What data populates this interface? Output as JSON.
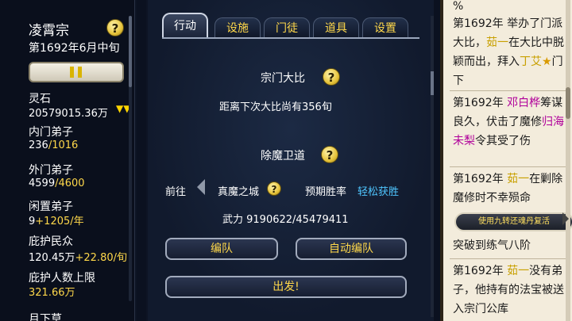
{
  "left": {
    "sect_name": "凌霄宗",
    "date": "第1692年6月中旬",
    "stats": [
      {
        "label": "灵石",
        "value": "20579015.36万",
        "extra": ""
      },
      {
        "label": "内门弟子",
        "value": "236",
        "extra": "/1016"
      },
      {
        "label": "外门弟子",
        "value": "4599",
        "extra": "/4600"
      },
      {
        "label": "闲置弟子",
        "value": "9",
        "extra": "+1205/年"
      },
      {
        "label": "庇护民众",
        "value": "120.45万",
        "extra": "+22.80/旬"
      },
      {
        "label": "庇护人数上限",
        "value": "",
        "extra": "321.66万"
      },
      {
        "label": "月下草",
        "value": "",
        "extra": ""
      }
    ],
    "trend_icon": "▼▼"
  },
  "main": {
    "tabs": [
      "行动",
      "设施",
      "门徒",
      "道具",
      "设置"
    ],
    "active_tab": 0,
    "contest_title": "宗门大比",
    "contest_text": "距离下次大比尚有356旬",
    "demon_title": "除魔卫道",
    "goto_label": "前往",
    "city": "真魔之城",
    "win_rate_label": "预期胜率",
    "win_rate_value": "轻松获胜",
    "force_text": "武力 9190622/45479411",
    "btn_formation": "编队",
    "btn_auto_formation": "自动编队",
    "btn_depart": "出发!"
  },
  "log": {
    "top_cut": "%",
    "entries_html_parts": {
      "e1a": "第1692年 举办了门派大比，",
      "e1b": "茹一",
      "e1c": "在大比中脱颖而出，拜入",
      "e1d": "丁艾",
      "e1e": "★",
      "e1f": "门下",
      "e2a": "第1692年 ",
      "e2b": "邓白桦",
      "e2c": "筹谋良久，伏击了魔修",
      "e2d": "归海未梨",
      "e2e": "令其受了伤",
      "e3a": "第1692年 ",
      "e3b": "茹一",
      "e3c": "在剿除魔修时不幸殒命",
      "e4": "突破到练气八阶",
      "e5a": "第1692年 ",
      "e5b": "茹一",
      "e5c": "没有弟子，他持有的法宝被送入宗门公库"
    },
    "revive_btn": "使用九转还魂丹复活"
  },
  "colors": {
    "accent": "#ffd84a",
    "blue": "#4fc6ff",
    "purple": "#b0009a"
  }
}
